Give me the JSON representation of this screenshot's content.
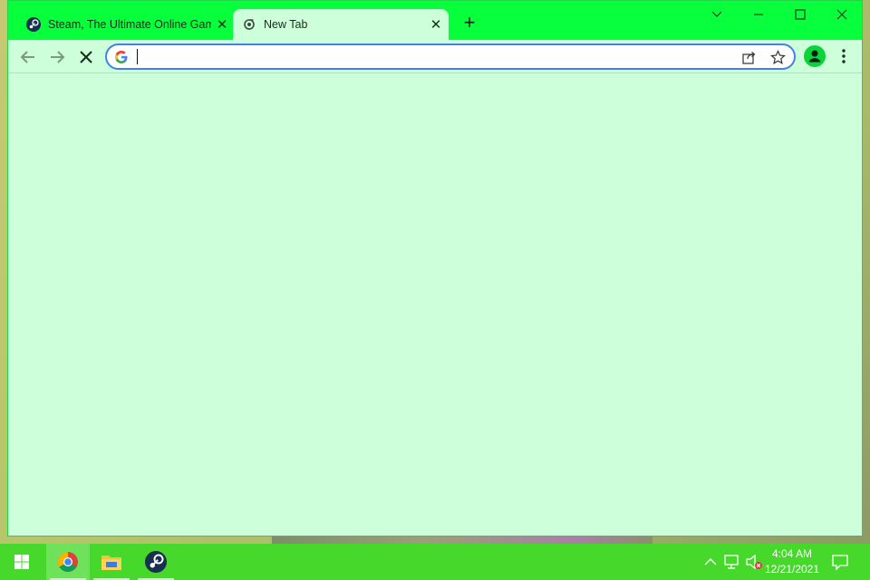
{
  "browser": {
    "tabs": [
      {
        "title": "Steam, The Ultimate Online Gam",
        "favicon": "steam-icon",
        "active": false
      },
      {
        "title": "New Tab",
        "favicon": "newtab-icon",
        "active": true
      }
    ],
    "new_tab_symbol": "+",
    "tab_close_symbol": "✕",
    "omnibox": {
      "value": "",
      "placeholder": ""
    },
    "colors": {
      "frame": "#08ff3c",
      "toolbar": "#ccffda",
      "omnibox_border": "#3f83e8"
    }
  },
  "taskbar": {
    "apps": [
      "windows-start-icon",
      "chrome-icon",
      "file-explorer-icon",
      "steam-icon"
    ],
    "clock": {
      "time": "4:04 AM",
      "date": "12/21/2021"
    },
    "color": "#47d82c"
  }
}
